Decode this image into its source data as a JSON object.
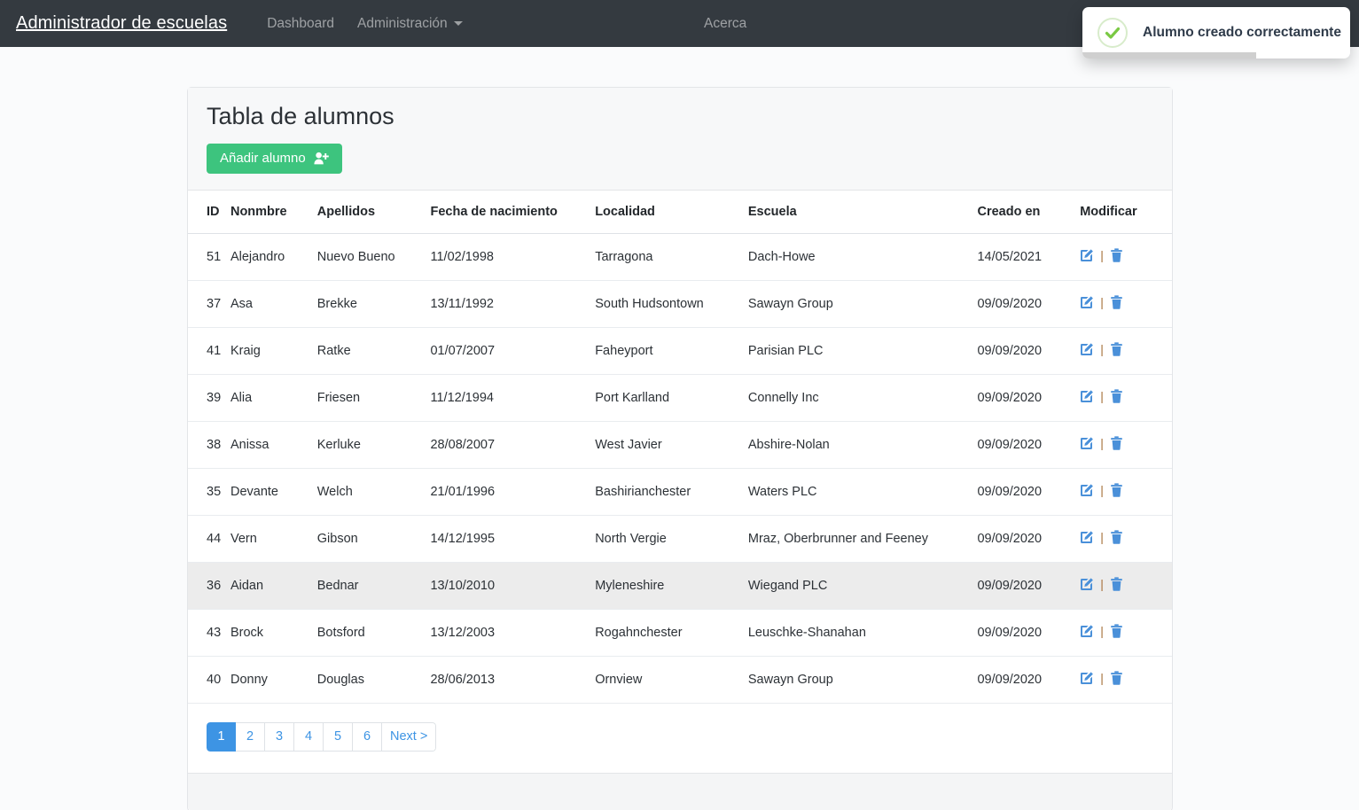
{
  "navbar": {
    "brand": "Administrador de escuelas",
    "links": [
      {
        "label": "Dashboard",
        "name": "nav-link-dashboard",
        "caret": false
      },
      {
        "label": "Administración",
        "name": "nav-link-administracion",
        "caret": true
      }
    ],
    "right_link": "Acerca",
    "background": "#343a40"
  },
  "toast": {
    "message": "Alumno creado correctamente",
    "icon": "check-circle-icon",
    "progress_percent": 65,
    "accent": "#7ac943"
  },
  "card": {
    "title": "Tabla de alumnos",
    "add_button": {
      "label": "Añadir alumno",
      "icon": "user-plus-icon",
      "color": "#3dc47e"
    }
  },
  "table": {
    "columns": [
      "ID",
      "Nonmbre",
      "Apellidos",
      "Fecha de nacimiento",
      "Localidad",
      "Escuela",
      "Creado en",
      "Modificar"
    ],
    "row_actions": {
      "edit_icon": "edit-pencil-square-icon",
      "separator": "|",
      "delete_icon": "trash-icon",
      "color": "#4a90d9"
    },
    "rows": [
      {
        "id": "51",
        "nombre": "Alejandro",
        "apellidos": "Nuevo Bueno",
        "fecha": "11/02/1998",
        "localidad": "Tarragona",
        "escuela": "Dach-Howe",
        "creado": "14/05/2021",
        "hovered": false
      },
      {
        "id": "37",
        "nombre": "Asa",
        "apellidos": "Brekke",
        "fecha": "13/11/1992",
        "localidad": "South Hudsontown",
        "escuela": "Sawayn Group",
        "creado": "09/09/2020",
        "hovered": false
      },
      {
        "id": "41",
        "nombre": "Kraig",
        "apellidos": "Ratke",
        "fecha": "01/07/2007",
        "localidad": "Faheyport",
        "escuela": "Parisian PLC",
        "creado": "09/09/2020",
        "hovered": false
      },
      {
        "id": "39",
        "nombre": "Alia",
        "apellidos": "Friesen",
        "fecha": "11/12/1994",
        "localidad": "Port Karlland",
        "escuela": "Connelly Inc",
        "creado": "09/09/2020",
        "hovered": false
      },
      {
        "id": "38",
        "nombre": "Anissa",
        "apellidos": "Kerluke",
        "fecha": "28/08/2007",
        "localidad": "West Javier",
        "escuela": "Abshire-Nolan",
        "creado": "09/09/2020",
        "hovered": false
      },
      {
        "id": "35",
        "nombre": "Devante",
        "apellidos": "Welch",
        "fecha": "21/01/1996",
        "localidad": "Bashirianchester",
        "escuela": "Waters PLC",
        "creado": "09/09/2020",
        "hovered": false
      },
      {
        "id": "44",
        "nombre": "Vern",
        "apellidos": "Gibson",
        "fecha": "14/12/1995",
        "localidad": "North Vergie",
        "escuela": "Mraz, Oberbrunner and Feeney",
        "creado": "09/09/2020",
        "hovered": false
      },
      {
        "id": "36",
        "nombre": "Aidan",
        "apellidos": "Bednar",
        "fecha": "13/10/2010",
        "localidad": "Myleneshire",
        "escuela": "Wiegand PLC",
        "creado": "09/09/2020",
        "hovered": true
      },
      {
        "id": "43",
        "nombre": "Brock",
        "apellidos": "Botsford",
        "fecha": "13/12/2003",
        "localidad": "Rogahnchester",
        "escuela": "Leuschke-Shanahan",
        "creado": "09/09/2020",
        "hovered": false
      },
      {
        "id": "40",
        "nombre": "Donny",
        "apellidos": "Douglas",
        "fecha": "28/06/2013",
        "localidad": "Ornview",
        "escuela": "Sawayn Group",
        "creado": "09/09/2020",
        "hovered": false
      }
    ]
  },
  "pagination": {
    "items": [
      {
        "label": "1",
        "active": true
      },
      {
        "label": "2",
        "active": false
      },
      {
        "label": "3",
        "active": false
      },
      {
        "label": "4",
        "active": false
      },
      {
        "label": "5",
        "active": false
      },
      {
        "label": "6",
        "active": false
      },
      {
        "label": "Next >",
        "active": false
      }
    ],
    "active_color": "#3d94e4"
  }
}
